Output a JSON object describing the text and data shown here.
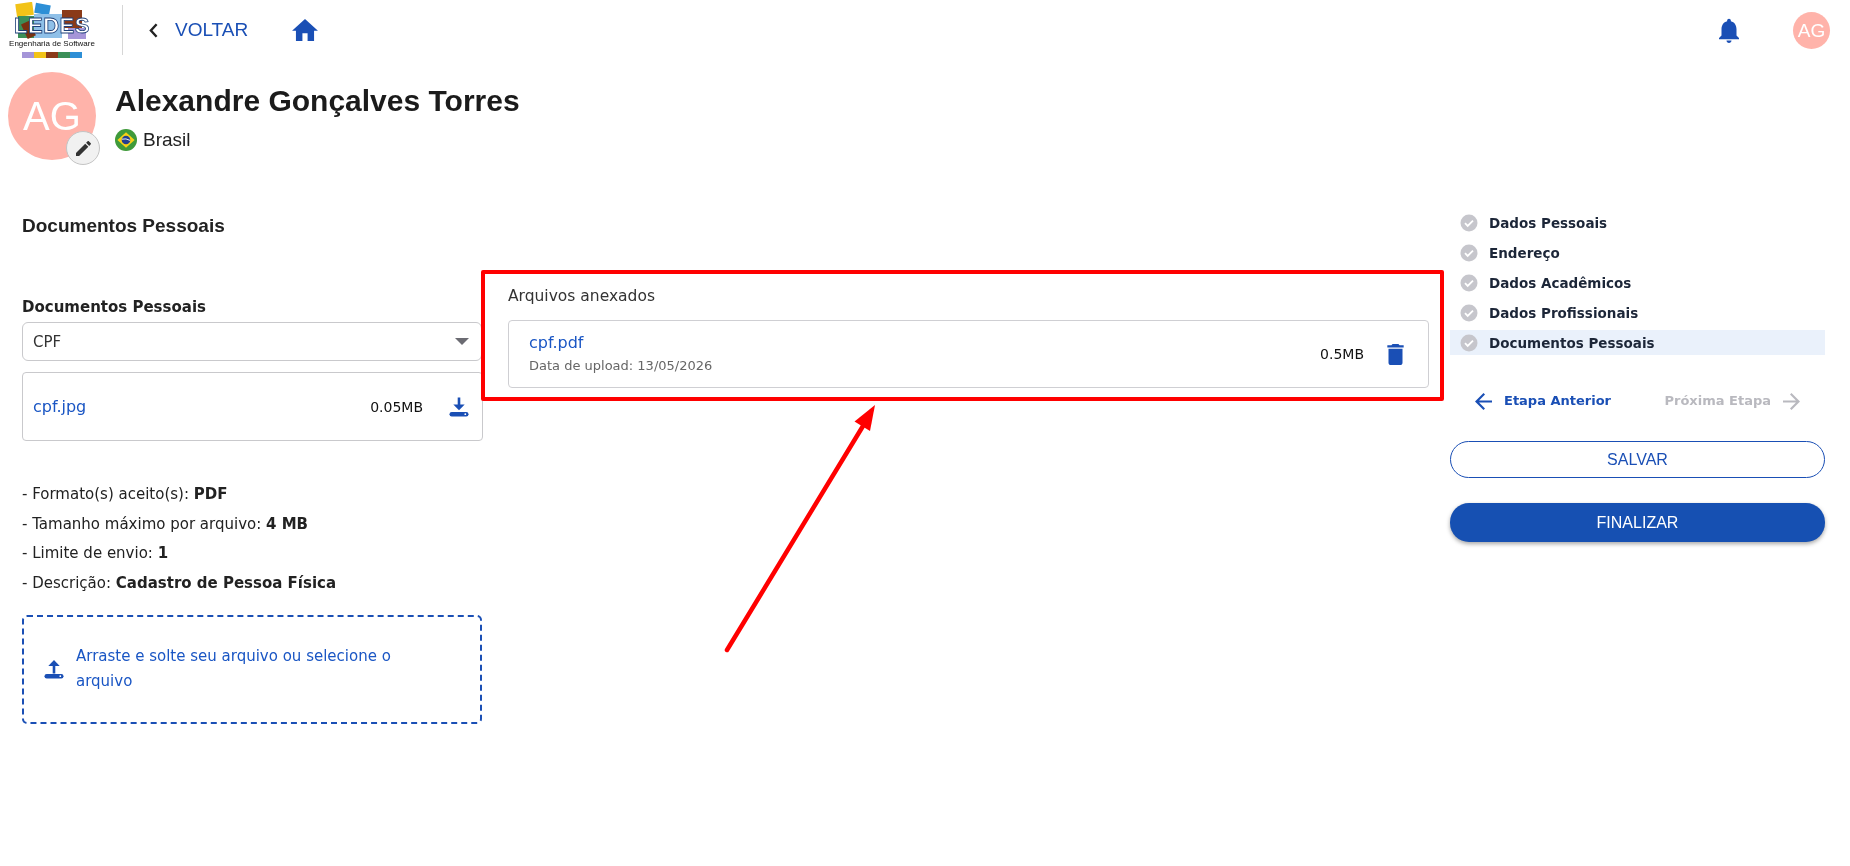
{
  "header": {
    "logo": {
      "title": "LEDES",
      "subtitle": "Engenharia de Software"
    },
    "back_link": {
      "label": "VOLTAR"
    },
    "user": {
      "initials": "AG"
    }
  },
  "profile": {
    "initials": "AG",
    "name": "Alexandre Gonçalves Torres",
    "country": "Brasil"
  },
  "documents": {
    "title": "Documentos Pessoais",
    "select": {
      "label": "Documentos Pessoais",
      "value": "CPF"
    },
    "files": [
      {
        "name": "cpf.jpg",
        "size": "0.05MB"
      }
    ],
    "requirements": [
      "- Formato(s) aceito(s): **PDF**",
      "- Tamanho máximo por arquivo: **4 MB**",
      "- Limite de envio: **1**",
      "- Descrição: **Cadastro de Pessoa Física**"
    ],
    "dropzone": {
      "text": "Arraste e solte seu arquivo ou selecione o arquivo"
    }
  },
  "attached_files": {
    "title": "Arquivos anexados",
    "highlighted": true,
    "files": [
      {
        "name": "cpf.pdf",
        "upload_date": "Data de upload: 13/05/2026",
        "size": "0.5MB"
      }
    ]
  },
  "steps": {
    "items": [
      {
        "label": "Dados Pessoais",
        "completed": true,
        "selected": false
      },
      {
        "label": "Endereço",
        "completed": true,
        "selected": false
      },
      {
        "label": "Dados Acadêmicos",
        "completed": true,
        "selected": false
      },
      {
        "label": "Dados Profissionais",
        "completed": true,
        "selected": false
      },
      {
        "label": "Documentos Pessoais",
        "completed": true,
        "selected": true
      }
    ],
    "navigation": [
      {
        "label": "Etapa Anterior",
        "kind": "previous",
        "disabled": false
      },
      {
        "label": "Próxima Etapa",
        "kind": "next",
        "disabled": true
      }
    ],
    "buttons": [
      {
        "label": "SALVAR",
        "kind": "outlined"
      },
      {
        "label": "FINALIZAR",
        "kind": "filled"
      }
    ]
  }
}
